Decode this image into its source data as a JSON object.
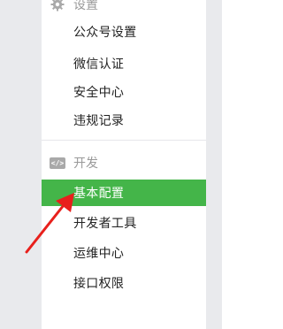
{
  "menu": {
    "settings_section": {
      "label": "设置",
      "icon": "gear-icon"
    },
    "settings_items": [
      {
        "label": "公众号设置"
      },
      {
        "label": "微信认证"
      },
      {
        "label": "安全中心"
      },
      {
        "label": "违规记录"
      }
    ],
    "dev_section": {
      "label": "开发",
      "icon": "code-icon",
      "icon_text": "</>"
    },
    "dev_items": [
      {
        "label": "基本配置",
        "active": true
      },
      {
        "label": "开发者工具"
      },
      {
        "label": "运维中心"
      },
      {
        "label": "接口权限"
      }
    ]
  },
  "colors": {
    "active_bg": "#44b549",
    "annotation_arrow": "#e8201c"
  }
}
